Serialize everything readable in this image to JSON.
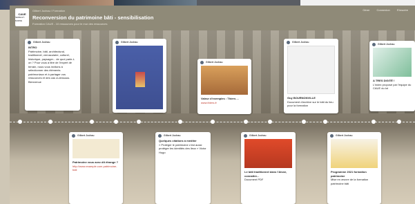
{
  "header": {
    "logo_line1": "CAUE",
    "logo_line2": "SEINE-ET-MARNE",
    "breadcrumb": "Gilbert Jochau  /  Formation",
    "title": "Reconversion du patrimoine bâti - sensibilisation",
    "subtitle": "Formation CAUE - 10 ressources pour le mur des ressources",
    "nav": [
      "Gérer",
      "Connexion",
      "S'inscrire"
    ]
  },
  "cards": [
    {
      "author": "Gilbert Jochau",
      "title": "INTRO",
      "body": "Patrimoine, bâti, architectural, traditionnel, vernaculaire, culturel, historique, paysager... de quoi parle-t-on ? Pour vous à titre de l'expert de terrain, nous vous invitons à sélectionner des éléments patrimoniaux et à partager vos ressources et des cas ci-dessous. Bienvenue"
    },
    {
      "author": "Gilbert Jochau",
      "title": "",
      "body": ""
    },
    {
      "author": "Gilbert Jochau",
      "title": "Valeur d'exemples : Thiers ...",
      "body": "www.thiers.fr"
    },
    {
      "author": "Gilbert Jochau",
      "title": "Guy BOURNONVILLE",
      "body": "Document d'archive sur le bâti du lieu pour la formation"
    },
    {
      "author": "Gilbert Jochau",
      "title": "A TRES DIGITÉ !",
      "body": "L'index proposé par l'équipe du CAUE du lot"
    },
    {
      "author": "Gilbert Jochau",
      "title": "Patrimoine vous avez dit étrange ?",
      "body": "http://www.example.com patrimoine-bati"
    },
    {
      "author": "Gilbert Jochau",
      "title": "Quelques citations à méditer",
      "body": "« Protéger le patrimoine c'est aussi protéger les identités des lieux » Victor Hugo"
    },
    {
      "author": "Gilbert Jochau",
      "title": "Le bâti traditionnel dans l'Aisne, connaître...",
      "body": "Document PDF"
    },
    {
      "author": "Gilbert Jochau",
      "title": "Programme 2021 formation patrimoine",
      "body": "Mise en œuvre de la formation patrimoine bâti"
    }
  ]
}
